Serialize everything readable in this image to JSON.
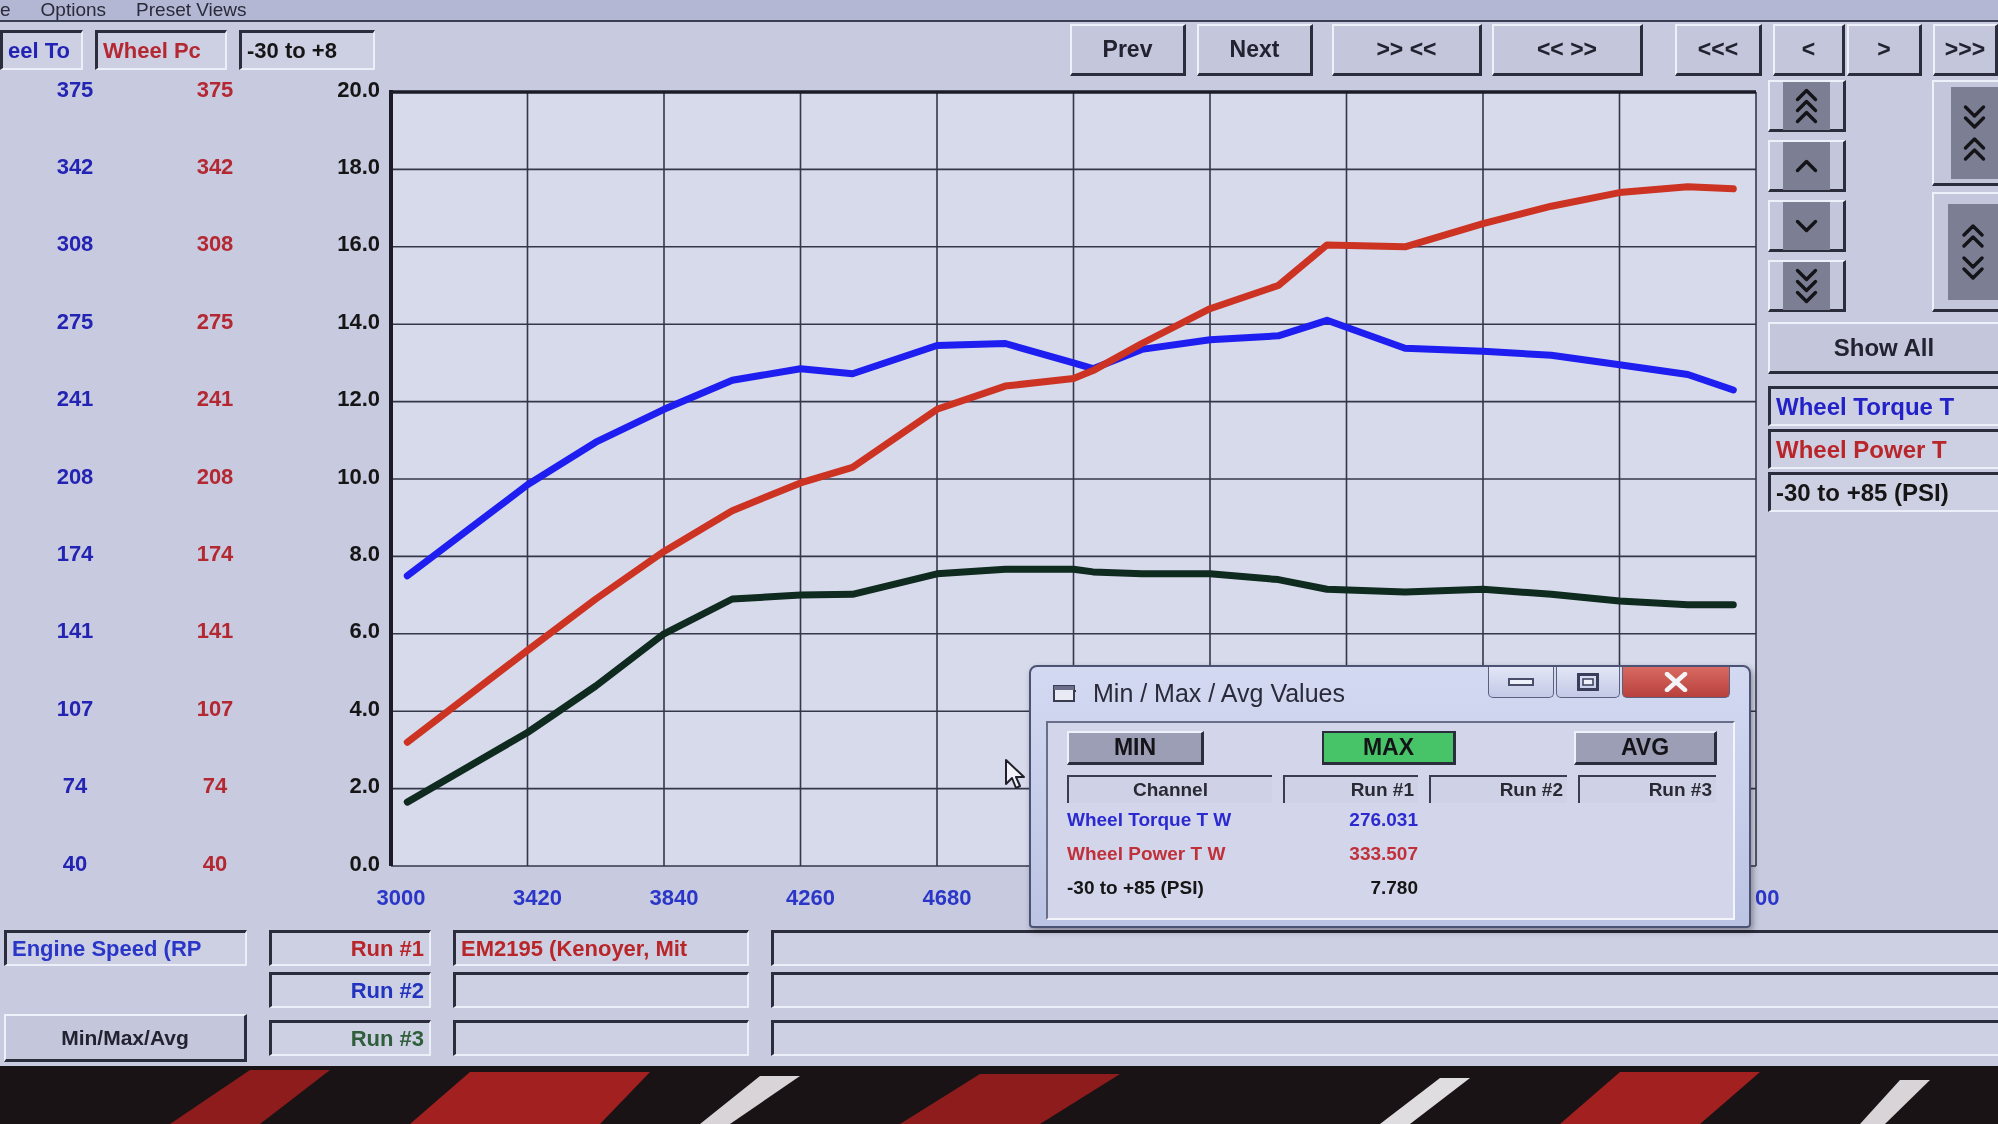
{
  "menu": [
    "e",
    "Options",
    "Preset Views"
  ],
  "axis_headers": [
    {
      "text": "eel To",
      "color": "#2424b4"
    },
    {
      "text": "Wheel Pc",
      "color": "#b42832"
    },
    {
      "text": "-30 to +8",
      "color": "#151515"
    }
  ],
  "axis_scales": [
    {
      "color": "#2424b4",
      "ticks": [
        "375",
        "342",
        "308",
        "275",
        "241",
        "208",
        "174",
        "141",
        "107",
        "74",
        "40"
      ]
    },
    {
      "color": "#b42832",
      "ticks": [
        "375",
        "342",
        "308",
        "275",
        "241",
        "208",
        "174",
        "141",
        "107",
        "74",
        "40"
      ]
    }
  ],
  "toolbar": [
    "Prev",
    "Next",
    ">> <<",
    "<< >>",
    "<<<",
    "<",
    ">",
    ">>>"
  ],
  "chart_data": {
    "type": "line",
    "grid": true,
    "x": [
      3050,
      3420,
      3630,
      3840,
      4050,
      4260,
      4420,
      4680,
      4890,
      5100,
      5160,
      5310,
      5520,
      5730,
      5880,
      6120,
      6360,
      6570,
      6780,
      6990,
      7130
    ],
    "xlim": [
      3000,
      7200
    ],
    "xticks": [
      3000,
      3420,
      3840,
      4260,
      4680
    ],
    "ylim": [
      0,
      20
    ],
    "yticks": [
      {
        "value": 20,
        "label": "20.0"
      },
      {
        "value": 18,
        "label": "18.0"
      },
      {
        "value": 16,
        "label": "16.0"
      },
      {
        "value": 14,
        "label": "14.0"
      },
      {
        "value": 12,
        "label": "12.0"
      },
      {
        "value": 10,
        "label": "10.0"
      },
      {
        "value": 8,
        "label": "8.0"
      },
      {
        "value": 6,
        "label": "6.0"
      },
      {
        "value": 4,
        "label": "4.0"
      },
      {
        "value": 2,
        "label": "2.0"
      },
      {
        "value": 0,
        "label": "0.0"
      }
    ],
    "series": [
      {
        "color": "#1e1ef0",
        "values": [
          7.5,
          9.85,
          10.95,
          11.8,
          12.55,
          12.85,
          12.72,
          13.45,
          13.5,
          13.0,
          12.85,
          13.35,
          13.6,
          13.7,
          14.1,
          13.38,
          13.3,
          13.2,
          12.95,
          12.7,
          12.3
        ]
      },
      {
        "color": "#cc3322",
        "values": [
          3.2,
          5.57,
          6.9,
          8.13,
          9.18,
          9.9,
          10.3,
          11.8,
          12.4,
          12.6,
          12.8,
          13.5,
          14.4,
          15.0,
          16.05,
          16.0,
          16.6,
          17.05,
          17.4,
          17.55,
          17.5
        ]
      },
      {
        "color": "#0f2a1f",
        "values": [
          1.65,
          3.45,
          4.65,
          6.0,
          6.9,
          7.0,
          7.02,
          7.55,
          7.67,
          7.67,
          7.6,
          7.55,
          7.55,
          7.4,
          7.15,
          7.08,
          7.15,
          7.02,
          6.85,
          6.75,
          6.75
        ]
      }
    ]
  },
  "x_axis_cut_label": "00",
  "right_panel": {
    "show_all": "Show All",
    "channels": [
      {
        "label": "Wheel Torque T",
        "color": "#2222c8"
      },
      {
        "label": "Wheel Power T",
        "color": "#b8262a"
      },
      {
        "label": "-30 to +85 (PSI)",
        "color": "#151515"
      }
    ]
  },
  "x_channel": "Engine Speed (RP",
  "runs": [
    {
      "label": "Run #1",
      "color": "#b8262a",
      "name": "EM2195 (Kenoyer, Mit"
    },
    {
      "label": "Run #2",
      "color": "#2233c0"
    },
    {
      "label": "Run #3",
      "color": "#2e5e3a"
    }
  ],
  "min_max_avg_button": "Min/Max/Avg",
  "dialog": {
    "title": "Min / Max / Avg Values",
    "modes": [
      {
        "label": "MIN",
        "selected": false
      },
      {
        "label": "MAX",
        "selected": true
      },
      {
        "label": "AVG",
        "selected": false
      }
    ],
    "columns": [
      "Channel",
      "Run #1",
      "Run #2",
      "Run #3"
    ],
    "rows": [
      {
        "channel": "Wheel Torque T W",
        "color": "#2a2ad0",
        "values": [
          "276.031"
        ]
      },
      {
        "channel": "Wheel Power T W",
        "color": "#c0303a",
        "values": [
          "333.507"
        ]
      },
      {
        "channel": "-30 to +85 (PSI)",
        "color": "#151515",
        "values": [
          "7.780"
        ]
      }
    ]
  }
}
